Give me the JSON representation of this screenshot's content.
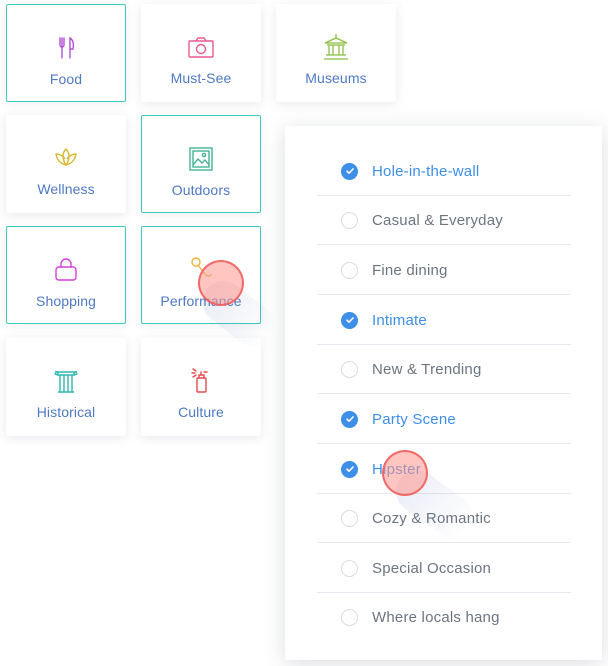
{
  "categories": [
    {
      "label": "Food",
      "icon": "fork-knife-icon",
      "selected": true
    },
    {
      "label": "Must-See",
      "icon": "camera-icon",
      "selected": false
    },
    {
      "label": "Museums",
      "icon": "museum-icon",
      "selected": false
    },
    {
      "label": "Wellness",
      "icon": "lotus-icon",
      "selected": false
    },
    {
      "label": "Outdoors",
      "icon": "landscape-picture-icon",
      "selected": true
    },
    {
      "label": "Shopping",
      "icon": "shopping-bag-icon",
      "selected": true
    },
    {
      "label": "Performance",
      "icon": "microphone-icon",
      "selected": true
    },
    {
      "label": "Historical",
      "icon": "column-icon",
      "selected": false
    },
    {
      "label": "Culture",
      "icon": "spray-can-icon",
      "selected": false
    }
  ],
  "options": [
    {
      "label": "Hole-in-the-wall",
      "checked": true
    },
    {
      "label": "Casual & Everyday",
      "checked": false
    },
    {
      "label": "Fine dining",
      "checked": false
    },
    {
      "label": "Intimate",
      "checked": true
    },
    {
      "label": "New & Trending",
      "checked": false
    },
    {
      "label": "Party Scene",
      "checked": true
    },
    {
      "label": "Hipster",
      "checked": true
    },
    {
      "label": "Cozy & Romantic",
      "checked": false
    },
    {
      "label": "Special Occasion",
      "checked": false
    },
    {
      "label": "Where locals hang",
      "checked": false
    }
  ],
  "colors": {
    "accent_blue": "#3d8fe8",
    "selected_border": "#3cc9bd",
    "label_blue": "#4e79c4",
    "unchecked_text": "#6c7580"
  }
}
